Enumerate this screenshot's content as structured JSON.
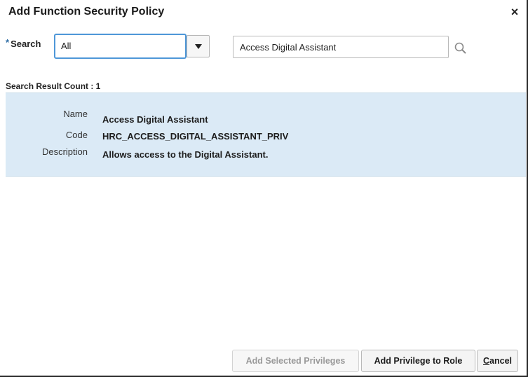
{
  "dialog": {
    "title": "Add Function Security Policy",
    "close_glyph": "×"
  },
  "search": {
    "required_marker": "*",
    "label": "Search",
    "scope_value": "All",
    "query_value": "Access Digital Assistant",
    "dropdown_icon": "triangle-down-icon",
    "search_icon": "magnifier-icon"
  },
  "results": {
    "count_text": "Search Result Count : 1",
    "item": {
      "name_label": "Name",
      "name_value": "Access Digital Assistant",
      "code_label": "Code",
      "code_value": "HRC_ACCESS_DIGITAL_ASSISTANT_PRIV",
      "description_label": "Description",
      "description_value": "Allows access to the Digital Assistant."
    }
  },
  "footer": {
    "add_selected_label": "Add Selected Privileges",
    "add_to_role_label": "Add Privilege to Role",
    "cancel_label_first": "C",
    "cancel_label_rest": "ancel"
  },
  "colors": {
    "selected_row_bg": "#dbeaf6",
    "focus_border": "#4e97d8",
    "required_marker": "#2f6ea5"
  }
}
